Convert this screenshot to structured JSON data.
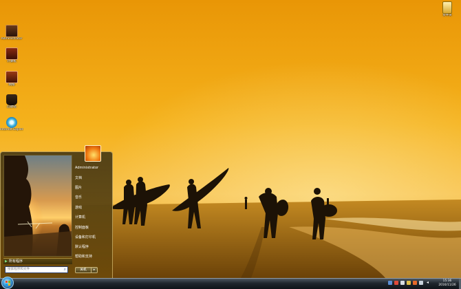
{
  "desktop": {
    "icons": [
      {
        "label": "Administrator",
        "icon": "user-folder-icon"
      },
      {
        "label": "计算机",
        "icon": "computer-icon"
      },
      {
        "label": "网络",
        "icon": "network-icon"
      },
      {
        "label": "回收站",
        "icon": "recycle-bin-icon"
      },
      {
        "label": "Internet Explorer",
        "icon": "internet-explorer-icon"
      }
    ],
    "top_right_icon": {
      "label": "文件夹",
      "icon": "folder-icon"
    }
  },
  "start_menu": {
    "right_items": [
      "Administrator",
      "文档",
      "图片",
      "音乐",
      "游戏",
      "计算机",
      "控制面板",
      "设备和打印机",
      "默认程序",
      "帮助和支持"
    ],
    "all_programs_label": "所有程序",
    "search_placeholder": "搜索程序和文件",
    "shutdown_label": "关机",
    "shutdown_arrow": "▸"
  },
  "taskbar": {
    "clock_time": "15:36",
    "clock_date": "2016/11/26"
  },
  "colors": {
    "wallpaper_sky": "#f2a60c",
    "taskbar": "#1f262d",
    "start_menu": "#5a4714"
  }
}
